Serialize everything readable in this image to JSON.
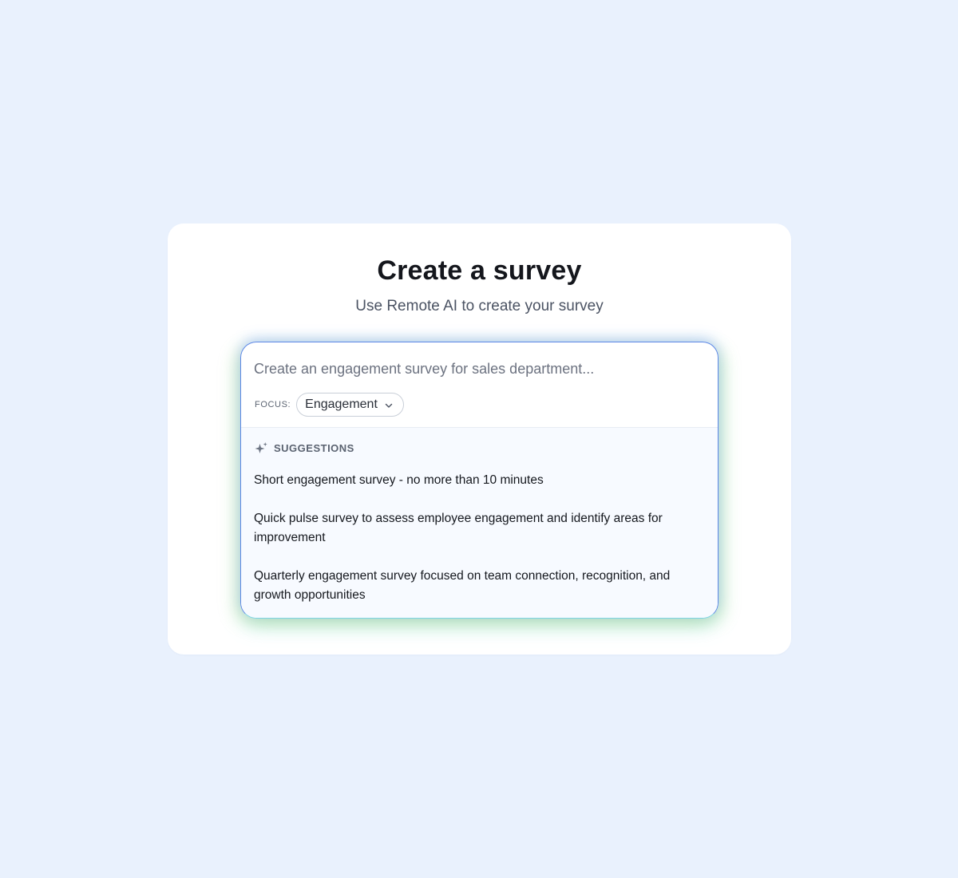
{
  "page": {
    "title": "Create a survey",
    "subtitle": "Use Remote AI to create your survey"
  },
  "prompt": {
    "placeholder": "Create an engagement survey for sales department...",
    "value": ""
  },
  "focus": {
    "label": "FOCUS:",
    "selected": "Engagement"
  },
  "suggestions": {
    "heading": "SUGGESTIONS",
    "items": [
      "Short engagement survey - no more than 10 minutes",
      "Quick pulse survey to assess employee engagement and identify areas for improvement",
      "Quarterly engagement survey focused on team connection, recognition, and growth opportunities"
    ]
  },
  "icons": {
    "chevron": "chevron-down-icon",
    "sparkle": "sparkle-icon"
  },
  "colors": {
    "background": "#e9f1fd",
    "card": "#ffffff",
    "border_top": "#5d88e6",
    "border_bottom": "#7dd3e3"
  }
}
